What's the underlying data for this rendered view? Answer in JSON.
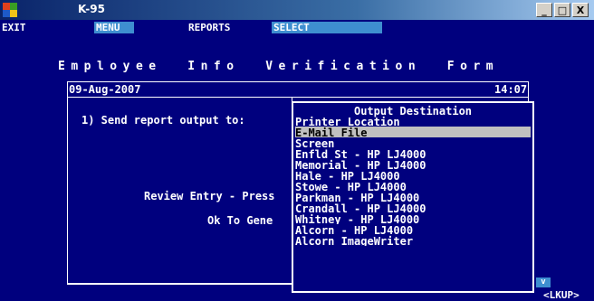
{
  "window": {
    "title": "K-95",
    "minimize": "_",
    "maximize": "□",
    "close": "X"
  },
  "menubar": {
    "items": [
      "EXIT",
      "MENU",
      "REPORTS",
      "SELECT"
    ],
    "highlighted": [
      "MENU",
      "SELECT"
    ]
  },
  "form": {
    "title": "Employee  Info  Verification  Form",
    "date": "09-Aug-2007",
    "time": "14:07",
    "prompt": "1) Send report output to:",
    "review": "Review Entry - Press",
    "ok": "Ok To Gene"
  },
  "dropdown": {
    "header": "Output Destination",
    "items": [
      "Printer_Location____",
      "E-Mail File",
      "Screen",
      "Enfld St - HP LJ4000",
      "Memorial - HP LJ4000",
      "Hale - HP LJ4000",
      "Stowe - HP LJ4000",
      "Parkman - HP LJ4000",
      "Crandall - HP LJ4000",
      "Whitney - HP LJ4000",
      "Alcorn - HP LJ4000",
      "Alcorn ImageWriter"
    ],
    "selected": "E-Mail File",
    "scroll": "v"
  },
  "status": {
    "lookup": "<LKUP>"
  },
  "colors": {
    "background": "#00007e",
    "highlight": "#3e8ed0",
    "selection": "#c0c0c0"
  }
}
